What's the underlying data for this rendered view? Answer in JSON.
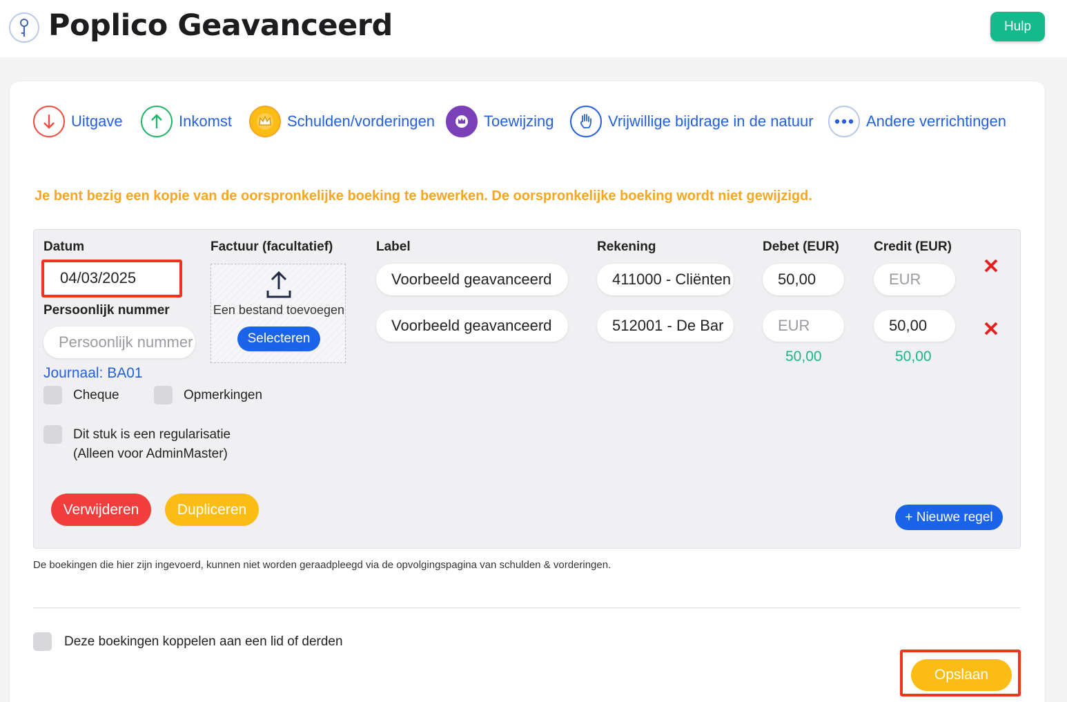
{
  "app": {
    "title": "Poplico Geavanceerd",
    "help_label": "Hulp"
  },
  "types": [
    {
      "label": "Uitgave",
      "icon": "arrow-down-icon",
      "color": "#f24b3f"
    },
    {
      "label": "Inkomst",
      "icon": "arrow-up-icon",
      "color": "#22b36b"
    },
    {
      "label": "Schulden/vorderingen",
      "icon": "crown-icon",
      "color": "#f5a623"
    },
    {
      "label": "Toewijzing",
      "icon": "assign-icon",
      "color": "#7b3fb8"
    },
    {
      "label": "Vrijwillige bijdrage in de natuur",
      "icon": "hand-icon",
      "color": "#2460dd"
    },
    {
      "label": "Andere verrichtingen",
      "icon": "more-dots-icon",
      "color": "#2460dd"
    }
  ],
  "warning": "Je bent bezig een kopie van de oorspronkelijke boeking te bewerken. De oorspronkelijke boeking wordt niet gewijzigd.",
  "form": {
    "date_label": "Datum",
    "date_value": "04/03/2025",
    "personal_number_label": "Persoonlijk nummer",
    "personal_number_placeholder": "Persoonlijk nummer",
    "journal": "Journaal: BA01",
    "invoice_label": "Factuur (facultatief)",
    "upload_text": "Een bestand toevoegen",
    "select_label": "Selecteren",
    "checkbox_cheque": "Cheque",
    "checkbox_remarks": "Opmerkingen",
    "checkbox_regularisation_line1": "Dit stuk is een regularisatie",
    "checkbox_regularisation_line2": "(Alleen voor AdminMaster)"
  },
  "table": {
    "headers": {
      "label": "Label",
      "account": "Rekening",
      "debit": "Debet (EUR)",
      "credit": "Credit (EUR)"
    },
    "placeholder_amount": "EUR",
    "rows": [
      {
        "label": "Voorbeeld geavanceerd",
        "account": "411000 - Cliënten",
        "debit": "50,00",
        "credit": ""
      },
      {
        "label": "Voorbeeld geavanceerd",
        "account": "512001 - De Bar",
        "debit": "",
        "credit": "50,00"
      }
    ],
    "total_debit": "50,00",
    "total_credit": "50,00"
  },
  "actions": {
    "delete": "Verwijderen",
    "duplicate": "Dupliceren",
    "new_line": "+ Nieuwe regel"
  },
  "note": "De boekingen die hier zijn ingevoerd, kunnen niet worden geraadpleegd via de opvolgingspagina van schulden & vorderingen.",
  "link_member_label": "Deze boekingen koppelen aan een lid of derden",
  "save_label": "Opslaan",
  "colors": {
    "accent_blue": "#1b63e8",
    "warning": "#f5a623",
    "save": "#fbbd14",
    "delete": "#f23d3d",
    "total_green": "#19b58a",
    "help_green": "#16b98c"
  }
}
